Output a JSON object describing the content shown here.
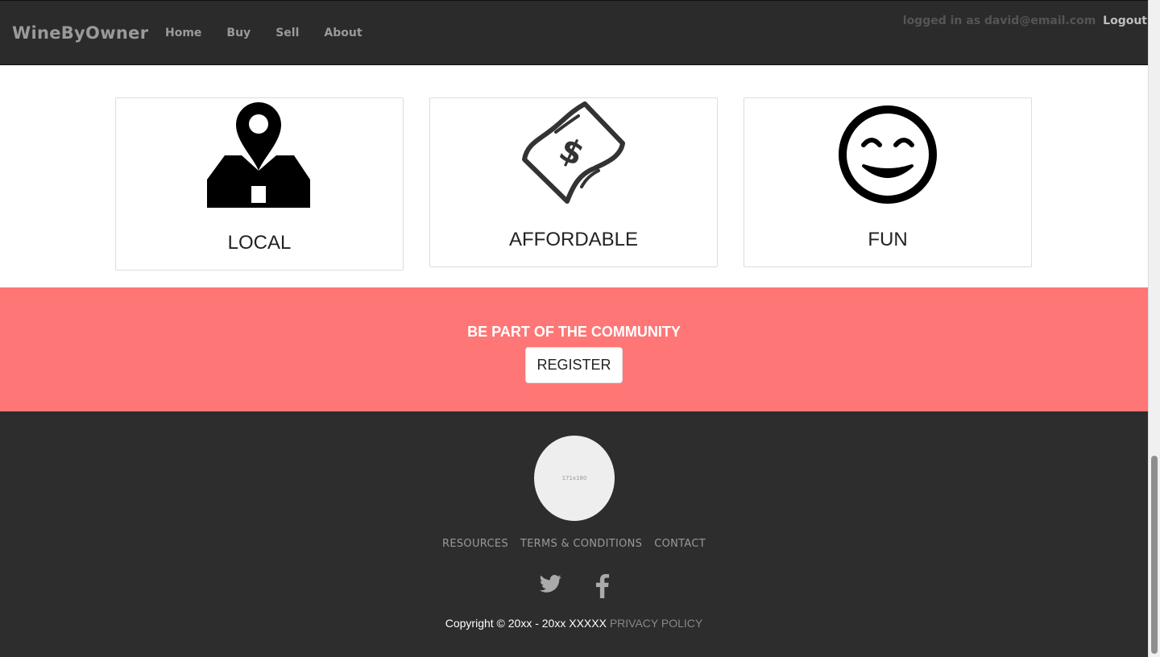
{
  "navbar": {
    "brand": "WineByOwner",
    "links": [
      "Home",
      "Buy",
      "Sell",
      "About"
    ],
    "logged_in_text": "logged in as david@email.com",
    "logout_label": "Logout"
  },
  "features": [
    {
      "title": "LOCAL",
      "icon": "map-pin-box-icon"
    },
    {
      "title": "AFFORDABLE",
      "icon": "dollar-bill-icon"
    },
    {
      "title": "FUN",
      "icon": "smiley-face-icon"
    }
  ],
  "cta": {
    "heading": "BE PART OF THE COMMUNITY",
    "button_label": "REGISTER",
    "background_color": "#ff7676"
  },
  "footer": {
    "logo_placeholder": "171x180",
    "links": [
      "RESOURCES",
      "TERMS & CONDITIONS",
      "CONTACT"
    ],
    "social_icons": [
      "twitter-icon",
      "facebook-icon"
    ],
    "copyright": "Copyright © 20xx - 20xx XXXXX",
    "privacy_label": "PRIVACY POLICY"
  }
}
